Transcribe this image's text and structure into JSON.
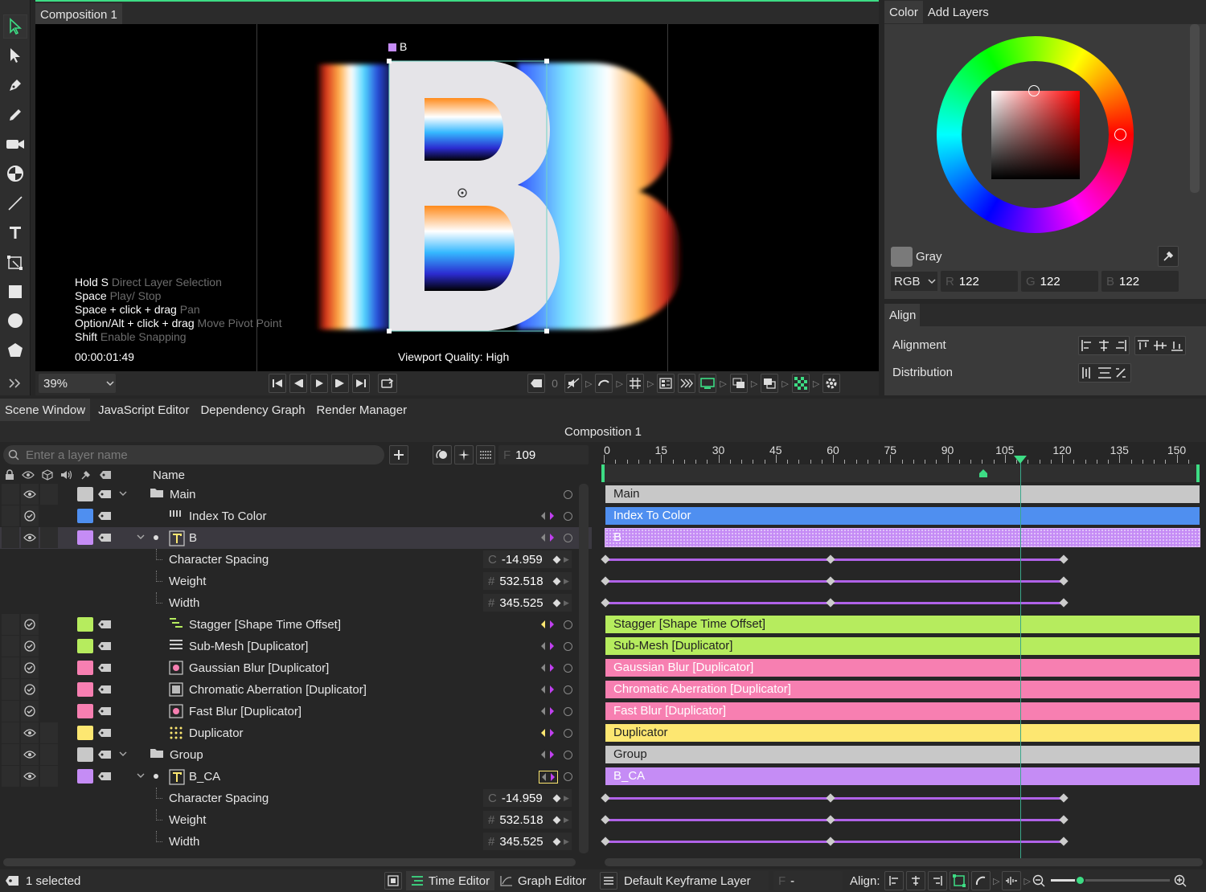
{
  "tools": [
    "select-icon",
    "direct-select-icon",
    "pen-icon",
    "pencil-icon",
    "camera-icon",
    "anchor-icon",
    "line-icon",
    "text-icon",
    "transform-icon",
    "rectangle-icon",
    "ellipse-icon",
    "polygon-icon",
    "expand-icon"
  ],
  "viewport": {
    "tab": "Composition 1",
    "layer_label": "B",
    "letter": "B",
    "hints": [
      {
        "key": "Hold S",
        "desc": "Direct Layer Selection"
      },
      {
        "key": "Space",
        "desc": "Play/ Stop"
      },
      {
        "key": "Space + click + drag",
        "desc": "Pan"
      },
      {
        "key": "Option/Alt + click + drag",
        "desc": "Move Pivot Point"
      },
      {
        "key": "Shift",
        "desc": "Enable Snapping"
      }
    ],
    "timecode": "00:00:01:49",
    "quality": "Viewport Quality: High",
    "zoom": "39%",
    "frame_counter": "0"
  },
  "color_panel": {
    "tabs": [
      "Color",
      "Add Layers"
    ],
    "swatch_name": "Gray",
    "mode": "RGB",
    "r_label": "R",
    "r": "122",
    "g_label": "G",
    "g": "122",
    "b_label": "B",
    "b": "122",
    "swatch_color": "#7a7a7a"
  },
  "align_panel": {
    "title": "Align",
    "alignment_label": "Alignment",
    "distribution_label": "Distribution"
  },
  "bottom_tabs": [
    "Scene Window",
    "JavaScript Editor",
    "Dependency Graph",
    "Render Manager"
  ],
  "composition_title": "Composition 1",
  "search_placeholder": "Enter a layer name",
  "frame_label": "F",
  "frame_value": "109",
  "name_header": "Name",
  "ruler": [
    "0",
    "15",
    "30",
    "45",
    "60",
    "75",
    "90",
    "105",
    "120",
    "135",
    "150"
  ],
  "playhead_frame": 109,
  "layers": [
    {
      "name": "Main",
      "color": "#c8c8c8",
      "track": "Main",
      "vis": "eye"
    },
    {
      "name": "Index To Color",
      "color": "#4f8ff0",
      "track": "Index To Color",
      "vis": "check"
    },
    {
      "name": "B",
      "color": "#c58cf5",
      "track": "B",
      "vis": "eye"
    },
    {
      "name": "Character Spacing",
      "prefix": "C",
      "value": "-14.959"
    },
    {
      "name": "Weight",
      "prefix": "#",
      "value": "532.518"
    },
    {
      "name": "Width",
      "prefix": "#",
      "value": "345.525"
    },
    {
      "name": "Stagger [Shape Time Offset]",
      "color": "#b6ec5e",
      "track": "Stagger [Shape Time Offset]",
      "vis": "check"
    },
    {
      "name": "Sub-Mesh [Duplicator]",
      "color": "#b6ec5e",
      "track": "Sub-Mesh [Duplicator]",
      "vis": "check"
    },
    {
      "name": "Gaussian Blur [Duplicator]",
      "color": "#f77fb1",
      "track": "Gaussian Blur [Duplicator]",
      "vis": "check"
    },
    {
      "name": "Chromatic Aberration [Duplicator]",
      "color": "#f77fb1",
      "track": "Chromatic Aberration [Duplicator]",
      "vis": "check"
    },
    {
      "name": "Fast Blur [Duplicator]",
      "color": "#f77fb1",
      "track": "Fast Blur [Duplicator]",
      "vis": "check"
    },
    {
      "name": "Duplicator",
      "color": "#fde771",
      "track": "Duplicator",
      "vis": "eye"
    },
    {
      "name": "Group",
      "color": "#c8c8c8",
      "track": "Group",
      "vis": "eye"
    },
    {
      "name": "B_CA",
      "color": "#c58cf5",
      "track": "B_CA",
      "vis": "eye"
    },
    {
      "name": "Character Spacing",
      "prefix": "C",
      "value": "-14.959"
    },
    {
      "name": "Weight",
      "prefix": "#",
      "value": "532.518"
    },
    {
      "name": "Width",
      "prefix": "#",
      "value": "345.525"
    }
  ],
  "status": {
    "selected": "1 selected",
    "time_editor": "Time Editor",
    "graph_editor": "Graph Editor",
    "keyframe_layer": "Default Keyframe Layer",
    "f_label": "F",
    "f_value": "-",
    "align_label": "Align:"
  }
}
